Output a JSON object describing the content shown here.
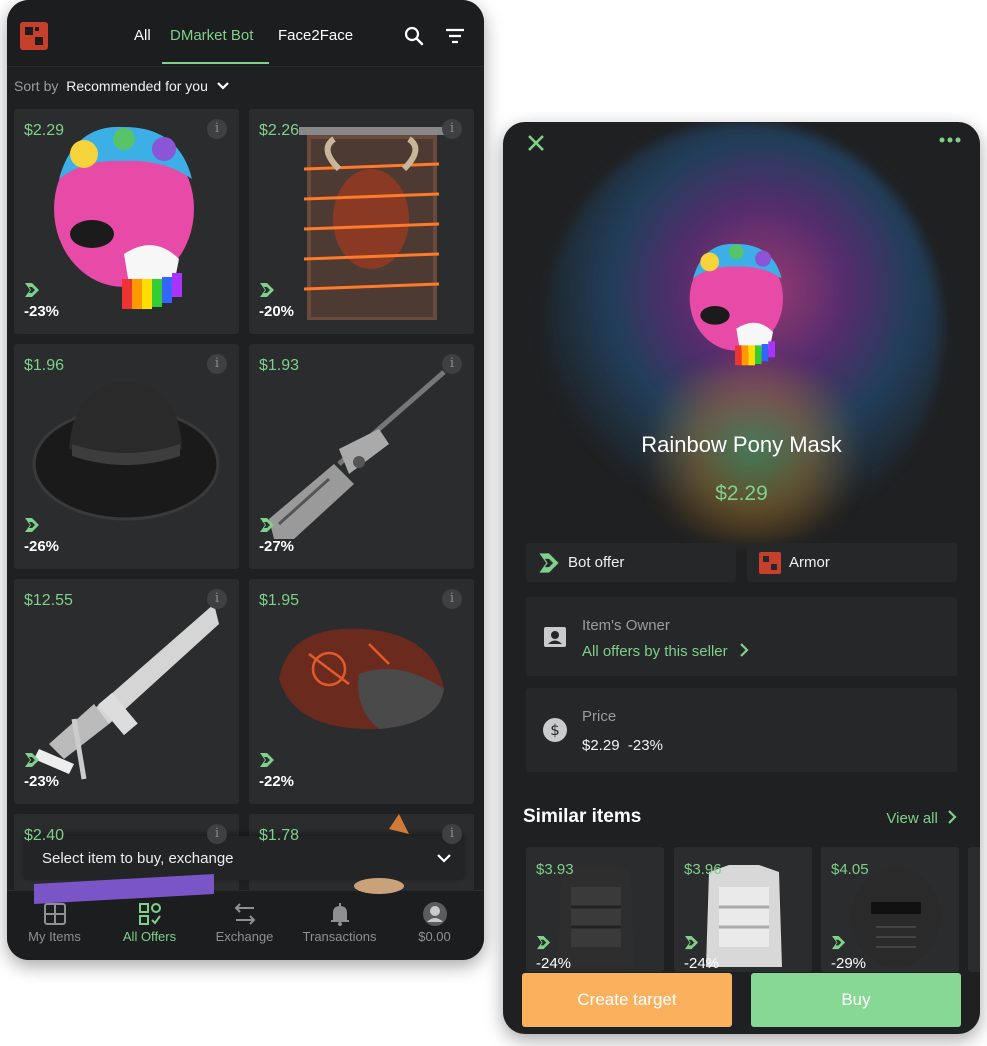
{
  "colors": {
    "accent_green": "#7fd08a",
    "bg_dark": "#1f2021",
    "card_bg": "#2b2c2d",
    "orange": "#fbb05e",
    "rust_red": "#c7402b"
  },
  "left": {
    "tabs": [
      {
        "label": "All"
      },
      {
        "label": "DMarket Bot"
      },
      {
        "label": "Face2Face"
      }
    ],
    "active_tab": "DMarket Bot",
    "icons": {
      "search": "search-icon",
      "filter": "filter-icon",
      "logo": "rust-logo-icon"
    },
    "sort": {
      "label": "Sort by",
      "value": "Recommended for you"
    },
    "items": [
      {
        "price": "$2.29",
        "discount": "-23%",
        "art": "rainbow-pony-mask"
      },
      {
        "price": "$2.26",
        "discount": "-20%",
        "art": "demon-banner-door"
      },
      {
        "price": "$1.96",
        "discount": "-26%",
        "art": "black-boonie-hat"
      },
      {
        "price": "$1.93",
        "discount": "-27%",
        "art": "bolt-rifle"
      },
      {
        "price": "$12.55",
        "discount": "-23%",
        "art": "white-thompson"
      },
      {
        "price": "$1.95",
        "discount": "-22%",
        "art": "rune-sack"
      },
      {
        "price": "$2.40",
        "discount": "",
        "art": "partial-item"
      },
      {
        "price": "$1.78",
        "discount": "",
        "art": "partial-item"
      }
    ],
    "select_bar": "Select item to buy, exchange",
    "nav": [
      {
        "label": "My Items",
        "icon": "grid-icon"
      },
      {
        "label": "All Offers",
        "icon": "offers-icon"
      },
      {
        "label": "Exchange",
        "icon": "exchange-icon"
      },
      {
        "label": "Transactions",
        "icon": "bell-icon"
      },
      {
        "label": "$0.00",
        "icon": "avatar-icon"
      }
    ],
    "active_nav": "All Offers"
  },
  "right": {
    "item_title": "Rainbow Pony Mask",
    "item_price": "$2.29",
    "chips": [
      {
        "label": "Bot offer",
        "icon": "dmarket-bot-icon"
      },
      {
        "label": "Armor",
        "icon": "rust-logo-icon"
      }
    ],
    "owner": {
      "label": "Item's Owner",
      "link": "All offers by this seller"
    },
    "price_panel": {
      "label": "Price",
      "value": "$2.29",
      "discount": "-23%"
    },
    "similar": {
      "heading": "Similar items",
      "view_all": "View all",
      "items": [
        {
          "price": "$3.93",
          "discount": "-24%",
          "art": "black-vest"
        },
        {
          "price": "$3.96",
          "discount": "-24%",
          "art": "white-vest"
        },
        {
          "price": "$4.05",
          "discount": "-29%",
          "art": "black-facemask"
        }
      ]
    },
    "buttons": {
      "create_target": "Create target",
      "buy": "Buy"
    }
  }
}
